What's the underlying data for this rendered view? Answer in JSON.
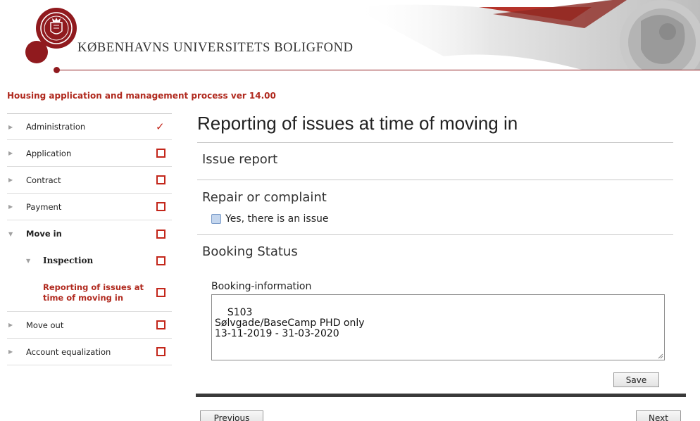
{
  "header": {
    "brand_name": "KØBENHAVNS UNIVERSITETS BOLIGFOND"
  },
  "process_title": "Housing application and management process ver 14.00",
  "sidebar": {
    "items": [
      {
        "label": "Administration",
        "status": "done"
      },
      {
        "label": "Application",
        "status": "todo"
      },
      {
        "label": "Contract",
        "status": "todo"
      },
      {
        "label": "Payment",
        "status": "todo"
      },
      {
        "label": "Move in",
        "status": "todo",
        "expanded": true
      },
      {
        "label": "Inspection",
        "status": "todo",
        "expanded": true
      },
      {
        "label": "Reporting of issues at time of moving in",
        "status": "todo",
        "current": true
      },
      {
        "label": "Move out",
        "status": "todo"
      },
      {
        "label": "Account equalization",
        "status": "todo"
      }
    ]
  },
  "main": {
    "page_title": "Reporting of issues at time of moving in",
    "sections": {
      "issue_report": "Issue report",
      "repair": "Repair or complaint",
      "booking_status": "Booking Status"
    },
    "issue_checkbox": {
      "label": "Yes, there is an issue",
      "checked": false
    },
    "booking_info": {
      "label": "Booking-information",
      "value": "S103\nSølvgade/BaseCamp PHD only\n13-11-2019 - 31-03-2020"
    },
    "save_label": "Save",
    "previous_label": "Previous",
    "next_label": "Next"
  },
  "colors": {
    "brand_red": "#901a1e",
    "accent_red": "#c3271b",
    "title_red": "#b0291e"
  }
}
